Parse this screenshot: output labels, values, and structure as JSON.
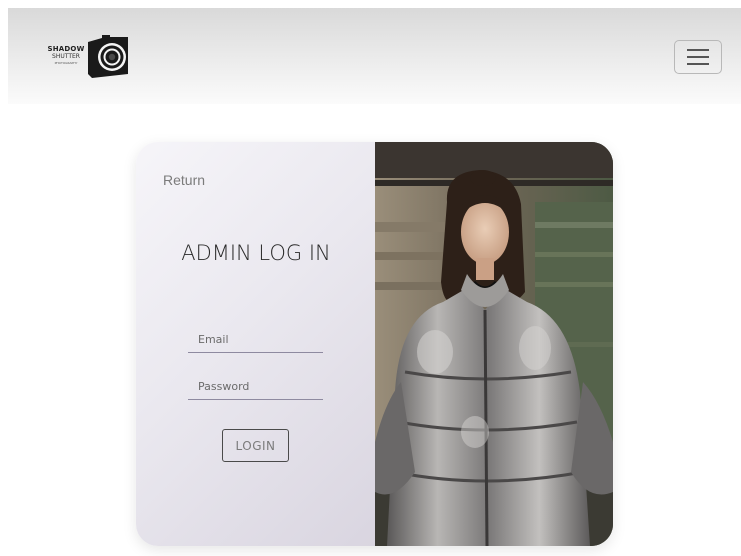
{
  "navbar": {
    "logo": {
      "title": "SHADOW",
      "subtitle": "SHUTTER",
      "tagline": "PHOTOGRAPHY",
      "icon": "camera-icon"
    },
    "menu_icon": "hamburger-icon"
  },
  "login_card": {
    "return_label": "Return",
    "title": "ADMIN LOG IN",
    "email_placeholder": "Email",
    "email_value": "",
    "password_placeholder": "Password",
    "password_value": "",
    "login_label": "LOGIN",
    "photo": "portrait-photo"
  },
  "colors": {
    "navbar_top": "#d9d9d9",
    "navbar_bottom": "#fbfbfb",
    "card_panel": "#eae8ef",
    "underline": "#8e8aa0",
    "jacket": "#9a9a9c",
    "background_wall": "#54624a"
  }
}
